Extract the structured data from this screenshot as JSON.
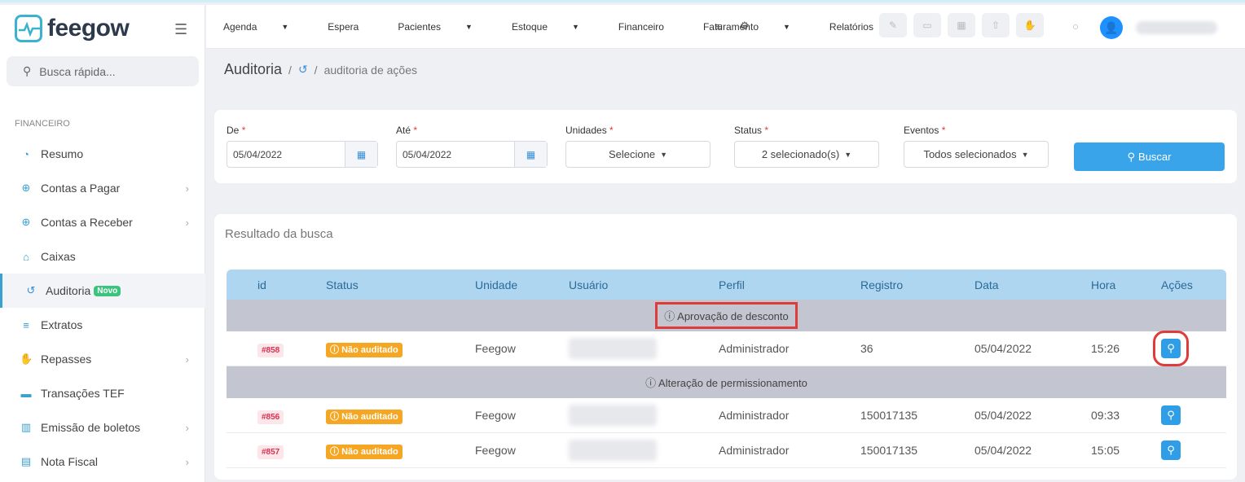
{
  "app": {
    "brand": "feegow"
  },
  "sidebar": {
    "search_placeholder": "Busca rápida...",
    "section": "FINANCEIRO",
    "items": [
      {
        "label": "Resumo",
        "icon": "chart-pie-icon",
        "chevron": false
      },
      {
        "label": "Contas a Pagar",
        "icon": "plus-circle-icon",
        "chevron": true
      },
      {
        "label": "Contas a Receber",
        "icon": "arrow-down-circle-icon",
        "chevron": true
      },
      {
        "label": "Caixas",
        "icon": "inbox-icon",
        "chevron": false
      },
      {
        "label": "Auditoria",
        "icon": "history-icon",
        "chevron": false,
        "badge": "Novo",
        "active": true
      },
      {
        "label": "Extratos",
        "icon": "list-icon",
        "chevron": false
      },
      {
        "label": "Repasses",
        "icon": "handshake-icon",
        "chevron": true
      },
      {
        "label": "Transações TEF",
        "icon": "card-icon",
        "chevron": false
      },
      {
        "label": "Emissão de boletos",
        "icon": "barcode-icon",
        "chevron": true
      },
      {
        "label": "Nota Fiscal",
        "icon": "file-icon",
        "chevron": true
      }
    ]
  },
  "topbar": {
    "menu": [
      {
        "label": "Agenda",
        "caret": true
      },
      {
        "label": "Espera",
        "caret": false
      },
      {
        "label": "Pacientes",
        "caret": true
      },
      {
        "label": "Estoque",
        "caret": true
      },
      {
        "label": "Financeiro",
        "caret": false
      },
      {
        "label": "Faturamento",
        "caret": true
      },
      {
        "label": "Relatórios",
        "caret": false
      }
    ]
  },
  "breadcrumb": {
    "title": "Auditoria",
    "sep": "/",
    "current": "auditoria de ações"
  },
  "filters": {
    "de": {
      "label": "De",
      "value": "05/04/2022"
    },
    "ate": {
      "label": "Até",
      "value": "05/04/2022"
    },
    "unidades": {
      "label": "Unidades",
      "value": "Selecione"
    },
    "status": {
      "label": "Status",
      "value": "2 selecionado(s)"
    },
    "eventos": {
      "label": "Eventos",
      "value": "Todos selecionados"
    },
    "buscar": "Buscar"
  },
  "results": {
    "title": "Resultado da busca",
    "headers": [
      "id",
      "Status",
      "Unidade",
      "Usuário",
      "Perfil",
      "Registro",
      "Data",
      "Hora",
      "Ações"
    ],
    "groups": [
      {
        "label": "Aprovação de desconto",
        "highlight": true,
        "rows": [
          {
            "id": "#858",
            "status": "Não auditado",
            "unidade": "Feegow",
            "perfil": "Administrador",
            "registro": "36",
            "data": "05/04/2022",
            "hora": "15:26",
            "highlight": true
          }
        ]
      },
      {
        "label": "Alteração de permissionamento",
        "highlight": false,
        "rows": [
          {
            "id": "#856",
            "status": "Não auditado",
            "unidade": "Feegow",
            "perfil": "Administrador",
            "registro": "150017135",
            "data": "05/04/2022",
            "hora": "09:33",
            "highlight": false
          },
          {
            "id": "#857",
            "status": "Não auditado",
            "unidade": "Feegow",
            "perfil": "Administrador",
            "registro": "150017135",
            "data": "05/04/2022",
            "hora": "15:05",
            "highlight": false
          }
        ]
      }
    ]
  },
  "colors": {
    "accent": "#3aa4ea",
    "highlight": "#e03b3b",
    "header_bg": "#aed6f1"
  }
}
